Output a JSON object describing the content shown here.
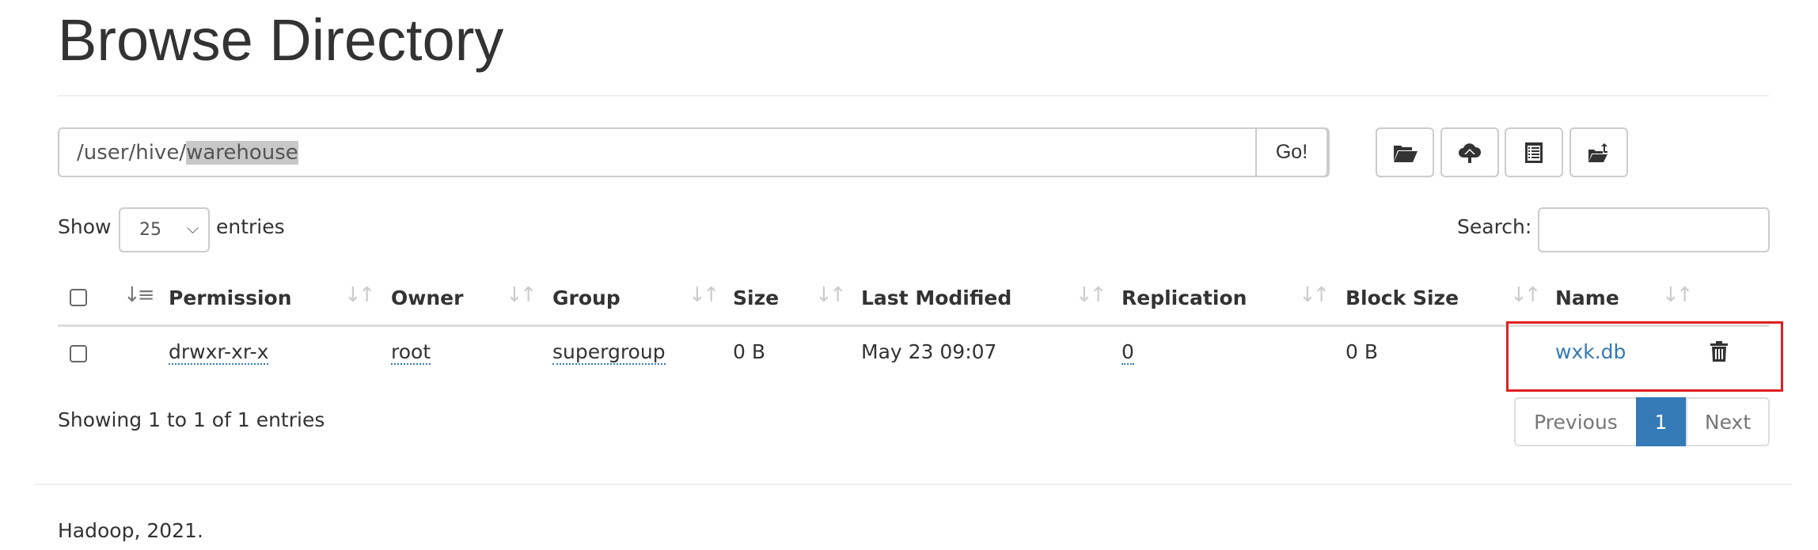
{
  "title": "Browse Directory",
  "path": {
    "prefix": "/user/hive/",
    "selected": "warehouse",
    "go_label": "Go!"
  },
  "toolbar": {
    "icons": [
      "folder-open-icon",
      "cloud-upload-icon",
      "list-alt-icon",
      "folder-upload-icon"
    ]
  },
  "show": {
    "label_before": "Show",
    "value": "25",
    "label_after": "entries"
  },
  "search": {
    "label": "Search:",
    "value": ""
  },
  "table": {
    "columns": [
      "Permission",
      "Owner",
      "Group",
      "Size",
      "Last Modified",
      "Replication",
      "Block Size",
      "Name"
    ],
    "rows": [
      {
        "permission": "drwxr-xr-x",
        "owner": "root",
        "group": "supergroup",
        "size": "0 B",
        "last_modified": "May 23 09:07",
        "replication": "0",
        "block_size": "0 B",
        "name": "wxk.db"
      }
    ]
  },
  "info": "Showing 1 to 1 of 1 entries",
  "pagination": {
    "previous": "Previous",
    "current": "1",
    "next": "Next"
  },
  "footer": "Hadoop, 2021.",
  "colors": {
    "link": "#337ab7",
    "highlight_border": "#e02020",
    "active_page": "#337ab7"
  }
}
